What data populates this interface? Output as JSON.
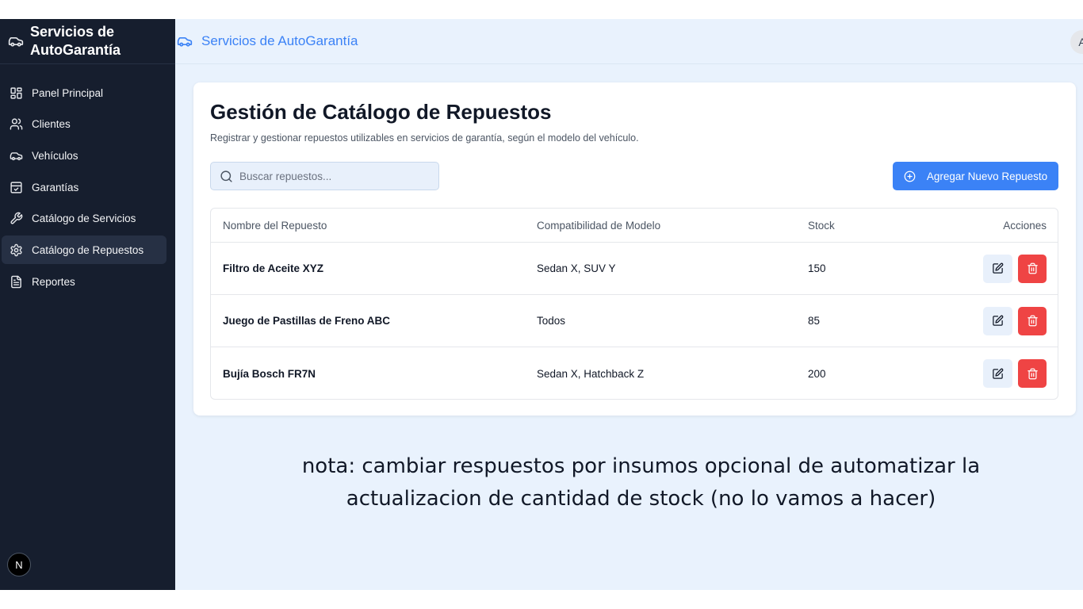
{
  "sidebar": {
    "brand": "Servicios de AutoGarantía",
    "items": [
      {
        "label": "Panel Principal",
        "icon": "dashboard-icon"
      },
      {
        "label": "Clientes",
        "icon": "users-icon"
      },
      {
        "label": "Vehículos",
        "icon": "car-icon"
      },
      {
        "label": "Garantías",
        "icon": "clipboard-check-icon"
      },
      {
        "label": "Catálogo de Servicios",
        "icon": "wrench-icon"
      },
      {
        "label": "Catálogo de Repuestos",
        "icon": "gear-icon",
        "active": true
      },
      {
        "label": "Reportes",
        "icon": "file-text-icon"
      }
    ],
    "badge": "N"
  },
  "header": {
    "title": "Servicios de AutoGarantía",
    "avatar": "A"
  },
  "page": {
    "title": "Gestión de Catálogo de Repuestos",
    "subtitle": "Registrar y gestionar repuestos utilizables en servicios de garantía, según el modelo del vehículo.",
    "search_placeholder": "Buscar repuestos...",
    "add_button": "Agregar Nuevo Repuesto"
  },
  "table": {
    "headers": [
      "Nombre del Repuesto",
      "Compatibilidad de Modelo",
      "Stock",
      "Acciones"
    ],
    "rows": [
      {
        "name": "Filtro de Aceite XYZ",
        "compat": "Sedan X, SUV Y",
        "stock": "150"
      },
      {
        "name": "Juego de Pastillas de Freno ABC",
        "compat": "Todos",
        "stock": "85"
      },
      {
        "name": "Bujía Bosch FR7N",
        "compat": "Sedan X, Hatchback Z",
        "stock": "200"
      }
    ]
  },
  "note": {
    "line1": "nota: cambiar respuestos por insumos opcional de automatizar la",
    "line2": "actualizacion de cantidad de stock (no lo vamos a hacer)"
  },
  "colors": {
    "sidebar_bg": "#161e2e",
    "accent": "#3b82f6",
    "danger": "#ef4444",
    "main_bg": "#e9f2fd"
  }
}
